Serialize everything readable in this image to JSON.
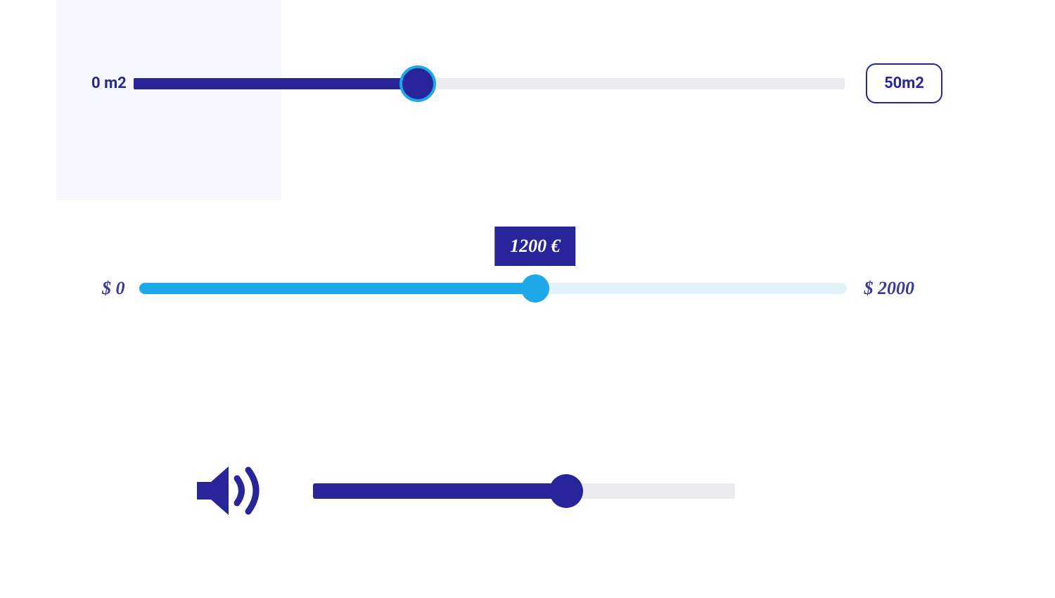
{
  "area_slider": {
    "min_label": "0 m2",
    "max_label": "50m2",
    "fill_percent": 40,
    "min_value": 0,
    "max_value": 50,
    "current_value": 20
  },
  "price_slider": {
    "min_label": "$ 0",
    "max_label": "$ 2000",
    "tooltip_label": "1200 €",
    "fill_percent": 56,
    "min_value": 0,
    "max_value": 2000,
    "current_value": 1200
  },
  "volume_slider": {
    "fill_percent": 60,
    "icon": "volume-icon"
  },
  "colors": {
    "primary": "#28259a",
    "accent": "#1da8e8",
    "track_bg": "#e8ecef",
    "track_bg_light": "#e1f2f8",
    "bg_tint": "#f5f9ff"
  }
}
